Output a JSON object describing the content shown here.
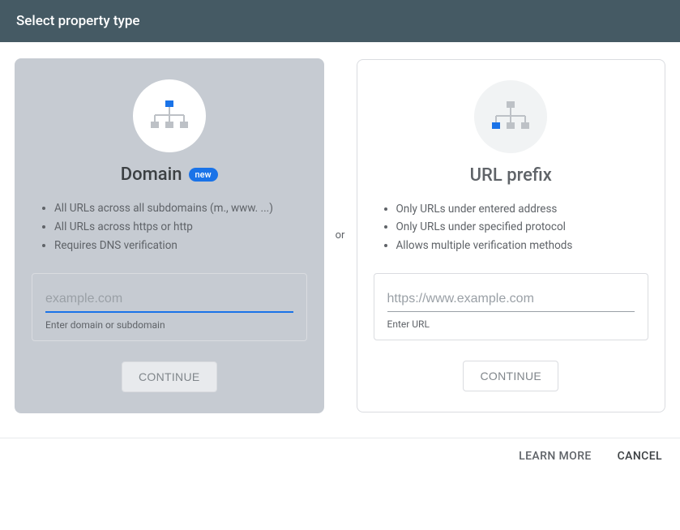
{
  "header": {
    "title": "Select property type"
  },
  "separator": "or",
  "domainCard": {
    "title": "Domain",
    "badge": "new",
    "bullets": [
      "All URLs across all subdomains (m., www. ...)",
      "All URLs across https or http",
      "Requires DNS verification"
    ],
    "placeholder": "example.com",
    "helper": "Enter domain or subdomain",
    "button": "CONTINUE"
  },
  "urlCard": {
    "title": "URL prefix",
    "bullets": [
      "Only URLs under entered address",
      "Only URLs under specified protocol",
      "Allows multiple verification methods"
    ],
    "placeholder": "https://www.example.com",
    "helper": "Enter URL",
    "button": "CONTINUE"
  },
  "footer": {
    "learn": "LEARN MORE",
    "cancel": "CANCEL"
  }
}
